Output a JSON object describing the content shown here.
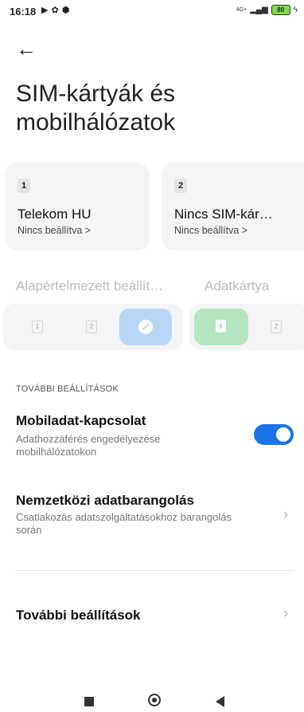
{
  "status_bar": {
    "time": "16:18",
    "net_label": "4G+",
    "battery": "80"
  },
  "page": {
    "title_line1": "SIM-kártyák és",
    "title_line2": "mobilhálózatok"
  },
  "sims": [
    {
      "slot": "1",
      "name": "Telekom HU",
      "sub": "Nincs beállítva >"
    },
    {
      "slot": "2",
      "name": "Nincs SIM-kár…",
      "sub": "Nincs beállítva >"
    }
  ],
  "defaults": {
    "default_label": "Alapértelmezett beállít…",
    "data_label": "Adatkártya",
    "seg1_items": [
      "1",
      "2"
    ],
    "seg2_items": [
      "2"
    ]
  },
  "settings": {
    "section_header": "TOVÁBBI BEÁLLÍTÁSOK",
    "mobile_data": {
      "title": "Mobiladat-kapcsolat",
      "subtitle": "Adathozzáférés engedélyezése mobilhálózatokon",
      "enabled": true
    },
    "roaming": {
      "title": "Nemzetközi adatbarangolás",
      "subtitle": "Csatlakozás adatszolgáltatásokhoz barangolás során"
    },
    "more": {
      "title": "További beállítások"
    }
  },
  "colors": {
    "accent": "#1a73e8",
    "sim1_selected": "#b8d7f8",
    "data_selected": "#b4e6c2"
  }
}
